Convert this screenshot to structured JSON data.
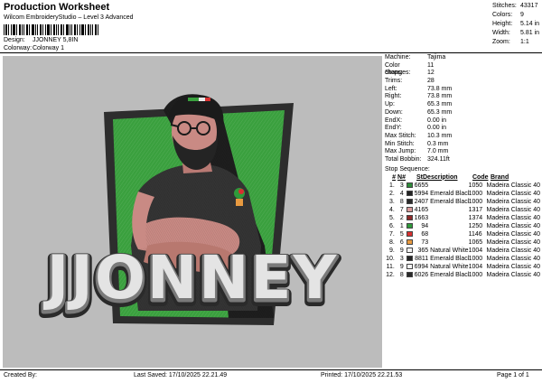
{
  "header": {
    "title": "Production Worksheet",
    "subtitle": "Wilcom EmbroideryStudio – Level 3 Advanced",
    "design_label": "Design:",
    "design_value": "JJONNEY 5,8IN",
    "colorway_label": "Colorway:",
    "colorway_value": "Colorway 1"
  },
  "stats": [
    {
      "label": "Stitches:",
      "value": "43317"
    },
    {
      "label": "Colors:",
      "value": "9"
    },
    {
      "label": "Height:",
      "value": "5.14 in"
    },
    {
      "label": "Width:",
      "value": "5.81 in"
    },
    {
      "label": "Zoom:",
      "value": "1:1"
    }
  ],
  "machine_info": [
    {
      "label": "Machine:",
      "value": "Tajima"
    },
    {
      "label": "Color changes:",
      "value": "11"
    },
    {
      "label": "Stops:",
      "value": "12"
    },
    {
      "label": "Trims:",
      "value": "28"
    },
    {
      "label": "Left:",
      "value": "73.8 mm"
    },
    {
      "label": "Right:",
      "value": "73.8 mm"
    },
    {
      "label": "Up:",
      "value": "65.3 mm"
    },
    {
      "label": "Down:",
      "value": "65.3 mm"
    },
    {
      "label": "EndX:",
      "value": "0.00 in"
    },
    {
      "label": "EndY:",
      "value": "0.00 in"
    },
    {
      "label": "Max Stitch:",
      "value": "10.3 mm"
    },
    {
      "label": "Min Stitch:",
      "value": "0.3 mm"
    },
    {
      "label": "Max Jump:",
      "value": "7.0 mm"
    },
    {
      "label": "Total Bobbin:",
      "value": "324.11ft"
    }
  ],
  "stop_sequence": {
    "title": "Stop Sequence:",
    "headers": {
      "num": "#",
      "n": "N#",
      "st": "St.",
      "desc": "Description",
      "code": "Code",
      "brand": "Brand"
    },
    "rows": [
      {
        "num": "1.",
        "n": "3",
        "color": "#2e8b3a",
        "st": "6655",
        "desc": "",
        "code": "1050",
        "brand": "Madeira Classic 40"
      },
      {
        "num": "2.",
        "n": "4",
        "color": "#222222",
        "st": "5994",
        "desc": "Emerald Black",
        "code": "1000",
        "brand": "Madeira Classic 40"
      },
      {
        "num": "3.",
        "n": "8",
        "color": "#2a2a2a",
        "st": "2407",
        "desc": "Emerald Black",
        "code": "1000",
        "brand": "Madeira Classic 40"
      },
      {
        "num": "4.",
        "n": "7",
        "color": "#d99a9a",
        "st": "4165",
        "desc": "",
        "code": "1317",
        "brand": "Madeira Classic 40"
      },
      {
        "num": "5.",
        "n": "2",
        "color": "#8e2a2a",
        "st": "1663",
        "desc": "",
        "code": "1374",
        "brand": "Madeira Classic 40"
      },
      {
        "num": "6.",
        "n": "1",
        "color": "#2f9a3a",
        "st": "94",
        "desc": "",
        "code": "1250",
        "brand": "Madeira Classic 40"
      },
      {
        "num": "7.",
        "n": "5",
        "color": "#d83030",
        "st": "68",
        "desc": "",
        "code": "1146",
        "brand": "Madeira Classic 40"
      },
      {
        "num": "8.",
        "n": "6",
        "color": "#e89a40",
        "st": "73",
        "desc": "",
        "code": "1065",
        "brand": "Madeira Classic 40"
      },
      {
        "num": "9.",
        "n": "9",
        "color": "#f2f2f2",
        "st": "365",
        "desc": "Natural White",
        "code": "1004",
        "brand": "Madeira Classic 40"
      },
      {
        "num": "10.",
        "n": "3",
        "color": "#252525",
        "st": "8811",
        "desc": "Emerald Black",
        "code": "1000",
        "brand": "Madeira Classic 40"
      },
      {
        "num": "11.",
        "n": "9",
        "color": "#f4f4f4",
        "st": "6994",
        "desc": "Natural White",
        "code": "1004",
        "brand": "Madeira Classic 40"
      },
      {
        "num": "12.",
        "n": "8",
        "color": "#2a2a2a",
        "st": "6026",
        "desc": "Emerald Black",
        "code": "1000",
        "brand": "Madeira Classic 40"
      }
    ]
  },
  "design": {
    "text": "JJONNEY",
    "colors": {
      "background": "#bcbcbc",
      "panel_green": "#3aa03e",
      "panel_border": "#2d2d2d",
      "shirt": "#343434",
      "skin": "#c98a84",
      "hair": "#1e1e1e",
      "letter_fill": "#e4e4e4",
      "letter_outline": "#3a3a3a"
    }
  },
  "footer": {
    "created_by": "Created By:",
    "last_saved": "Last Saved: 17/10/2025 22.21.49",
    "printed": "Printed: 17/10/2025 22.21.53",
    "page": "Page 1 of 1"
  }
}
